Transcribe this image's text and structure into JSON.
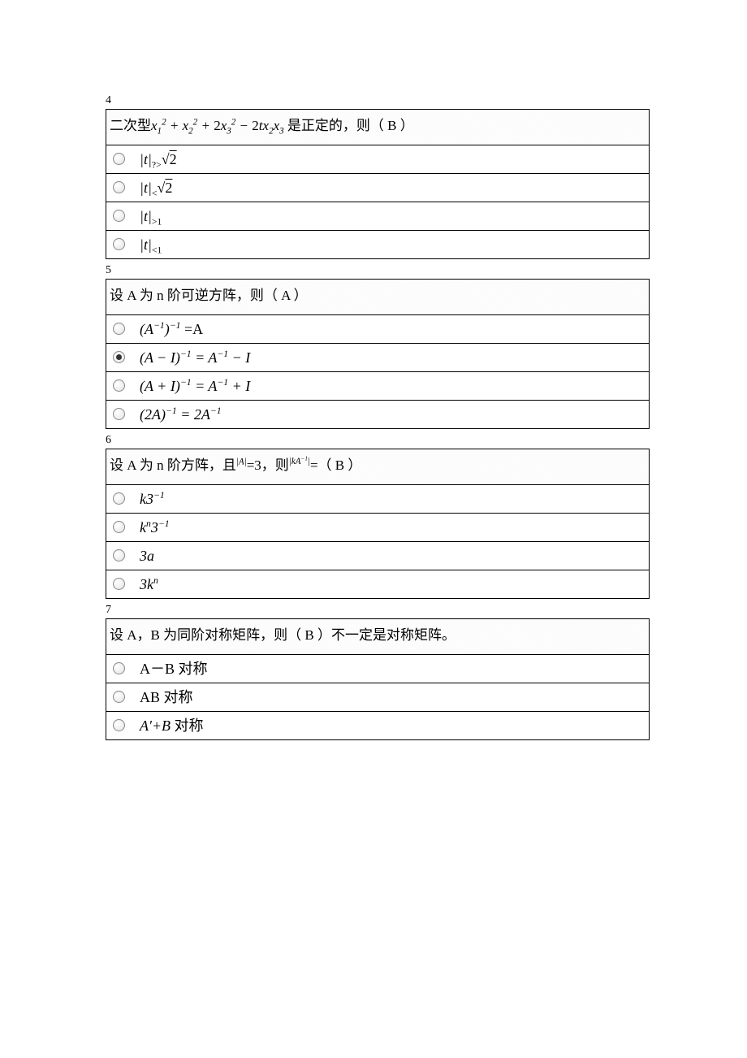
{
  "questions": [
    {
      "number": "4",
      "stem_html": "二次型<span class='math'>x<sub>1</sub><sup>2</sup> + x<sub>2</sub><sup>2</sup> + <span class='upright'>2</span>x<sub>3</sub><sup>2</sup> − <span class='upright'>2</span>tx<sub>2</sub>x<sub>3</sub></span> 是正定的，则（ B ）",
      "options": [
        {
          "html": "|<i>t</i>|<sub class='upright'>?&gt;</sub><span class='sqrt'>√<span class='ol'>2</span></span>",
          "selected": false
        },
        {
          "html": "|<i>t</i>|<sub class='upright'>&lt;</sub><span class='sqrt'>√<span class='ol'>2</span></span>",
          "selected": false
        },
        {
          "html": "|<i>t</i>|<sub class='upright'>&gt;1</sub>",
          "selected": false
        },
        {
          "html": "|<i>t</i>|<sub class='upright'>&lt;1</sub>",
          "selected": false
        }
      ]
    },
    {
      "number": "5",
      "stem_html": "设 A 为 n 阶可逆方阵，则（ A ）",
      "options": [
        {
          "html": "(<i>A</i><sup>−1</sup>)<sup>−1</sup> <span class='upright'>=A</span>",
          "selected": false
        },
        {
          "html": "(<i>A</i> − <i>I</i>)<sup>−1</sup> = <i>A</i><sup>−1</sup> − <i>I</i>",
          "selected": true
        },
        {
          "html": "(<i>A</i> + <i>I</i>)<sup>−1</sup> = <i>A</i><sup>−1</sup> + <i>I</i>",
          "selected": false
        },
        {
          "html": "(2<i>A</i>)<sup>−1</sup> = 2<i>A</i><sup>−1</sup>",
          "selected": false
        }
      ]
    },
    {
      "number": "6",
      "stem_html": "设 A 为 n 阶方阵，且<span class='math'><sup>|<i>A</i>|</sup></span>=3，则<span class='math'><sup>|<i>kA</i><sup>−1</sup>|</sup></span>=（ B ）",
      "options": [
        {
          "html": "<i>k</i>3<sup>−1</sup>",
          "selected": false
        },
        {
          "html": "<i>k</i><sup><i>n</i></sup>3<sup>−1</sup>",
          "selected": false
        },
        {
          "html": "3<i>a</i>",
          "selected": false
        },
        {
          "html": "3<i>k</i><sup><i>n</i></sup>",
          "selected": false
        }
      ]
    },
    {
      "number": "7",
      "stem_html": "设 A，B 为同阶对称矩阵，则（ B ）不一定是对称矩阵。",
      "options": [
        {
          "html": "<span class='cn'>A－B 对称</span>",
          "selected": false
        },
        {
          "html": "<span class='cn'>AB 对称</span>",
          "selected": false
        },
        {
          "html": "<i>A'</i>+<i>B</i> <span class='cn'>对称</span>",
          "selected": false
        }
      ]
    }
  ]
}
